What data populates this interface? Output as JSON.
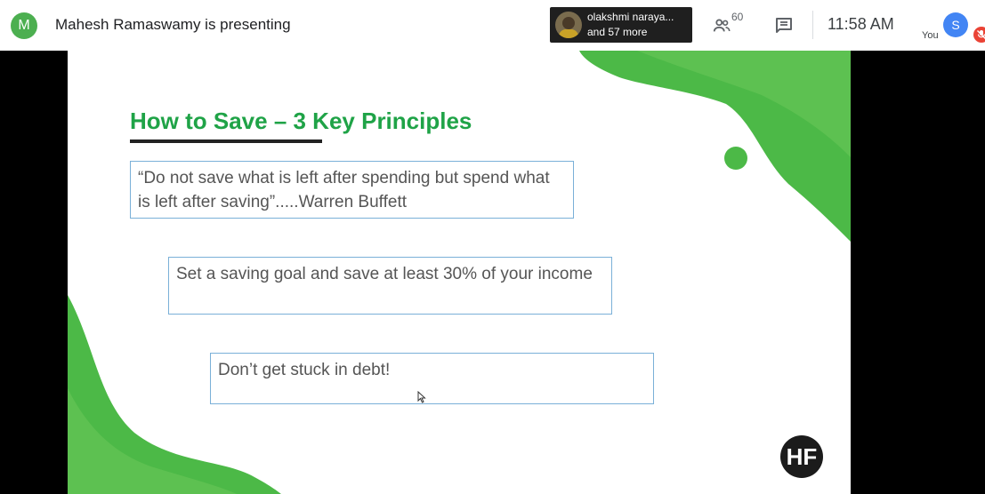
{
  "topbar": {
    "presenter_initial": "M",
    "presenting_text": "Mahesh Ramaswamy is presenting",
    "participants_popup": {
      "name": "olakshmi naraya...",
      "more": "and 57 more"
    },
    "people_count": "60",
    "time": "11:58 AM",
    "you_label": "You",
    "self_initial": "S"
  },
  "slide": {
    "title": "How to Save – 3 Key Principles",
    "principles": [
      "“Do not save what is left after spending but spend what is left after saving”.....Warren Buffett",
      "Set a saving goal and save at least 30% of your income",
      "Don’t get stuck in debt!"
    ],
    "logo_text": "HF"
  },
  "colors": {
    "title_green": "#1fa347",
    "blob_green": "#4cb947",
    "box_border": "#7ab0d8",
    "self_avatar": "#4285f4",
    "presenter_avatar": "#4caf50"
  },
  "icons": {
    "people": "people-icon",
    "chat": "chat-icon",
    "mic": "mic-off-icon"
  }
}
